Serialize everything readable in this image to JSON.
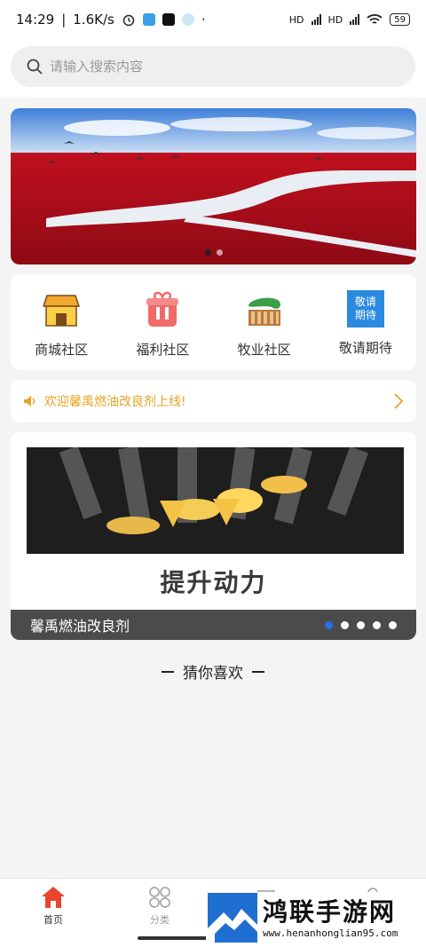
{
  "status_bar": {
    "time": "14:29",
    "speed": "1.6K/s",
    "battery": "59",
    "hd_label": "HD"
  },
  "search": {
    "placeholder": "请输入搜索内容"
  },
  "banner": {
    "dot_count": 2,
    "active_dot": 0
  },
  "categories": [
    {
      "label": "商城社区",
      "icon": "shop-icon"
    },
    {
      "label": "福利社区",
      "icon": "gift-icon"
    },
    {
      "label": "牧业社区",
      "icon": "farm-icon"
    },
    {
      "label": "敬请期待",
      "icon": "coming-soon-icon",
      "icon_text_1": "敬请",
      "icon_text_2": "期待"
    }
  ],
  "notice": {
    "text": "欢迎馨禹燃油改良剂上线!",
    "color": "#e8a323"
  },
  "product": {
    "slogan": "提升动力",
    "caption": "馨禹燃油改良剂",
    "dot_count": 5,
    "active_dot": 0
  },
  "section": {
    "title": "猜你喜欢"
  },
  "tabs": [
    {
      "label": "首页",
      "icon": "home-icon",
      "active": true
    },
    {
      "label": "分类",
      "icon": "category-icon",
      "active": false
    },
    {
      "label": "",
      "icon": "list-icon",
      "active": false
    },
    {
      "label": "",
      "icon": "user-icon",
      "active": false
    }
  ],
  "watermark": {
    "title": "鸿联手游网",
    "url": "www.henanhonglian95.com"
  },
  "colors": {
    "accent": "#e8452f",
    "notice": "#e8a323",
    "dot_active": "#2a6de8"
  }
}
